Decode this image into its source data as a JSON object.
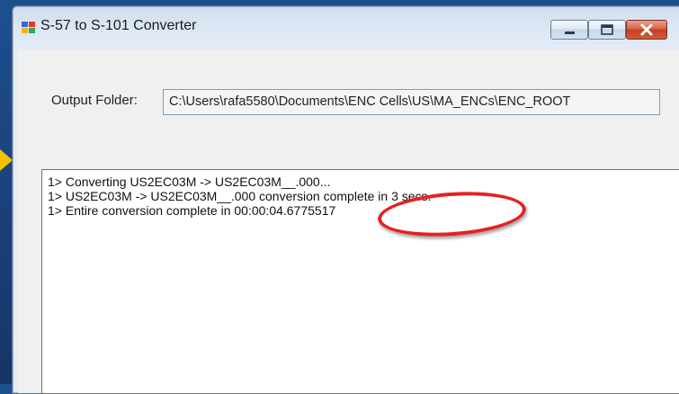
{
  "window": {
    "title": "S-57 to S-101 Converter",
    "buttons": {
      "minimize": "minimize",
      "maximize": "maximize",
      "close": "close"
    }
  },
  "output": {
    "label": "Output Folder:",
    "path": "C:\\Users\\rafa5580\\Documents\\ENC Cells\\US\\MA_ENCs\\ENC_ROOT"
  },
  "log": {
    "lines": [
      "1> Converting US2EC03M -> US2EC03M__.000...",
      "1> US2EC03M -> US2EC03M__.000 conversion complete in 3 secs.",
      "1> Entire conversion complete in 00:00:04.6775517"
    ]
  },
  "colors": {
    "highlight": "#e52121",
    "arrow": "#f2c200",
    "background": "#1d4f8f"
  }
}
